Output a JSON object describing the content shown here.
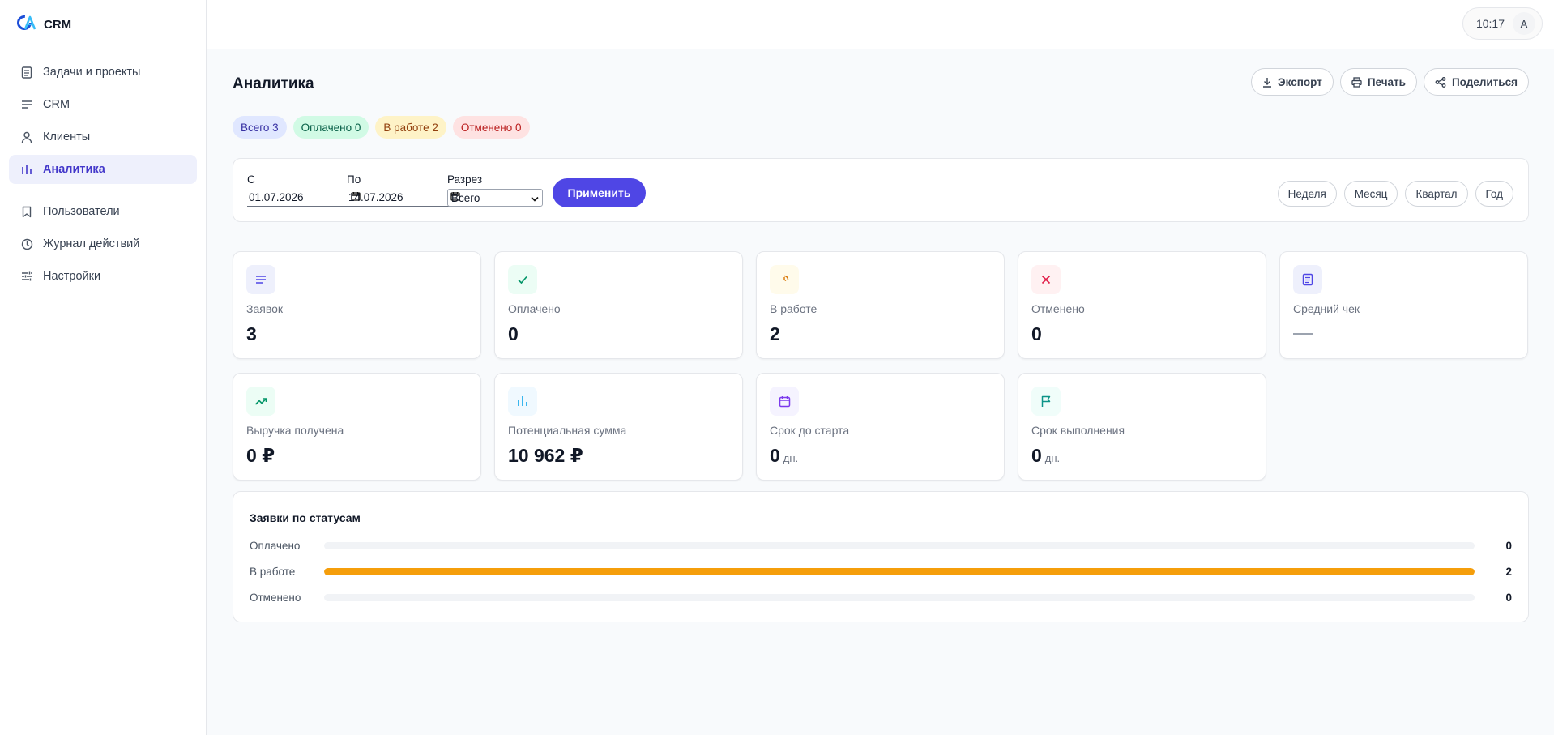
{
  "brand": {
    "name": "CRM"
  },
  "sidebar": {
    "items": [
      {
        "label": "Задачи и проекты",
        "icon": "document-icon",
        "active": false
      },
      {
        "label": "CRM",
        "icon": "list-icon",
        "active": false
      },
      {
        "label": "Клиенты",
        "icon": "user-icon",
        "active": false
      },
      {
        "label": "Аналитика",
        "icon": "bar-chart-icon",
        "active": true
      },
      {
        "label": "Пользователи",
        "icon": "bookmark-icon",
        "active": false
      },
      {
        "label": "Журнал действий",
        "icon": "clock-icon",
        "active": false
      },
      {
        "label": "Настройки",
        "icon": "sliders-icon",
        "active": false
      }
    ]
  },
  "topbar": {
    "time": "10:17",
    "avatar_letter": "A"
  },
  "page": {
    "title": "Аналитика"
  },
  "actions": {
    "export": "Экспорт",
    "print": "Печать",
    "share": "Поделиться"
  },
  "chips": {
    "total": "Всего 3",
    "paid": "Оплачено 0",
    "work": "В работе 2",
    "cancel": "Отменено 0"
  },
  "filter": {
    "from_label": "С",
    "from_value": "01.07.2026",
    "to_label": "По",
    "to_value": "14.07.2026",
    "slice_label": "Разрез",
    "slice_value": "Всего",
    "apply": "Применить",
    "periods": [
      "Неделя",
      "Месяц",
      "Квартал",
      "Год"
    ]
  },
  "stats": [
    {
      "label": "Заявок",
      "value": "3",
      "unit": "",
      "icon": "lines-icon",
      "color": "#4f46e5",
      "bg": "#eef0fc"
    },
    {
      "label": "Оплачено",
      "value": "0",
      "unit": "",
      "icon": "check-icon",
      "color": "#059669",
      "bg": "#ecfdf5"
    },
    {
      "label": "В работе",
      "value": "2",
      "unit": "",
      "icon": "spinner-icon",
      "color": "#d97706",
      "bg": "#fffbeb"
    },
    {
      "label": "Отменено",
      "value": "0",
      "unit": "",
      "icon": "x-icon",
      "color": "#e11d48",
      "bg": "#fff1f2"
    },
    {
      "label": "Средний чек",
      "value": "",
      "unit": "",
      "icon": "receipt-icon",
      "color": "#4f46e5",
      "bg": "#eef0fc"
    },
    {
      "label": "Выручка получена",
      "value": "0 ₽",
      "unit": "",
      "icon": "trending-up-icon",
      "color": "#059669",
      "bg": "#ecfdf5"
    },
    {
      "label": "Потенциальная сумма",
      "value": "10 962 ₽",
      "unit": "",
      "icon": "bar-chart-icon",
      "color": "#0ea5e9",
      "bg": "#f0f9ff"
    },
    {
      "label": "Срок до старта",
      "value": "0",
      "unit": "дн.",
      "icon": "calendar-icon",
      "color": "#7c3aed",
      "bg": "#f5f3ff"
    },
    {
      "label": "Срок выполнения",
      "value": "0",
      "unit": "дн.",
      "icon": "flag-icon",
      "color": "#0d9488",
      "bg": "#f0fdfa"
    }
  ],
  "status_chart": {
    "title": "Заявки по статусам",
    "max": 2,
    "fill_color": "#f59e0b",
    "rows": [
      {
        "label": "Оплачено",
        "value": 0
      },
      {
        "label": "В работе",
        "value": 2
      },
      {
        "label": "Отменено",
        "value": 0
      }
    ]
  }
}
